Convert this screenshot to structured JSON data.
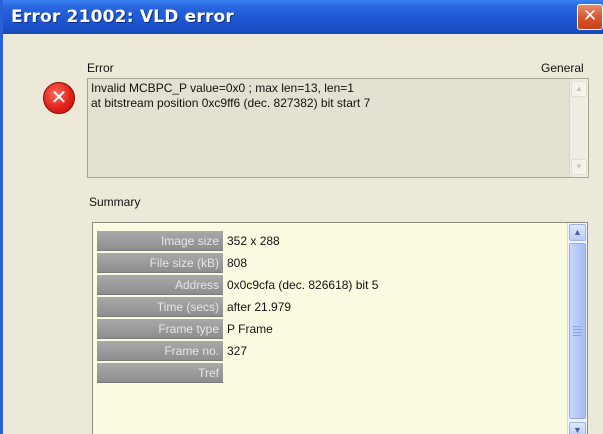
{
  "window": {
    "title": "Error 21002: VLD error",
    "close_glyph": "✕"
  },
  "error_section": {
    "label": "Error",
    "general_label": "General",
    "icon": "error-x-icon",
    "lines": [
      "Invalid MCBPC_P value=0x0 ; max len=13, len=1",
      "at bitstream position 0xc9ff6 (dec. 827382) bit start 7"
    ]
  },
  "summary": {
    "label": "Summary",
    "rows": [
      {
        "key": "Image size",
        "value": "352 x 288"
      },
      {
        "key": "File size (kB)",
        "value": "808"
      },
      {
        "key": "Address",
        "value": "0x0c9cfa (dec. 826618) bit 5"
      },
      {
        "key": "Time (secs)",
        "value": "after 21.979"
      },
      {
        "key": "Frame type",
        "value": "P Frame"
      },
      {
        "key": "Frame no.",
        "value": "327"
      },
      {
        "key": "Tref",
        "value": ""
      }
    ]
  },
  "colors": {
    "titlebar": "#1e57d4",
    "dialog_bg": "#ece9d8",
    "summary_bg": "#fbfbe1",
    "key_cell": "#9a9a9a",
    "close_button": "#d8572f",
    "error_icon": "#e2231a"
  }
}
